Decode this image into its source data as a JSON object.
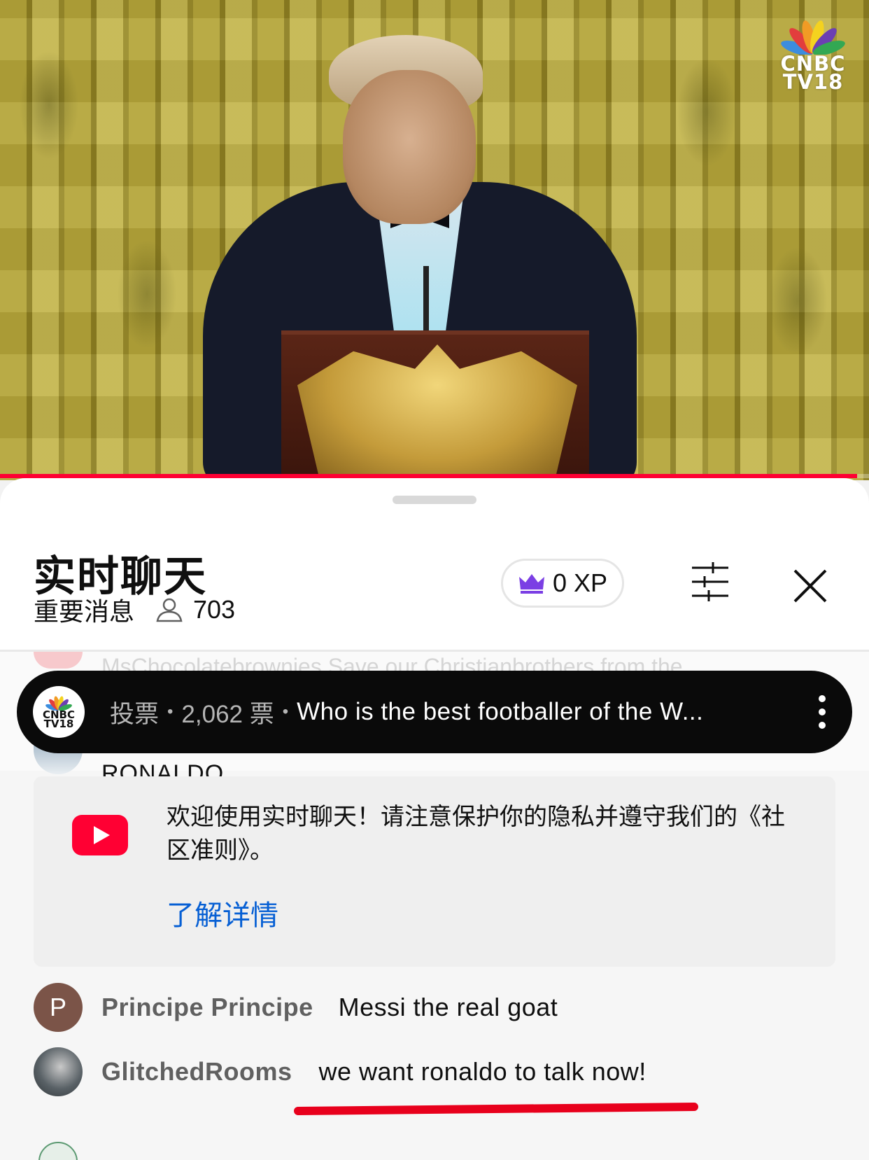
{
  "video": {
    "channel_logo_text": [
      "CNBC",
      "TV18"
    ],
    "progress": 0.986,
    "progress_color": "#ff0033"
  },
  "header": {
    "title": "实时聊天",
    "mode_label": "重要消息",
    "viewer_count": "703",
    "xp_label": "0 XP",
    "icons": [
      "crown-icon",
      "filter-icon",
      "close-icon",
      "person-icon"
    ]
  },
  "poll": {
    "meta_label": "投票",
    "votes": "2,062 票",
    "question": "Who is the best footballer of the W...",
    "channel_avatar_text": [
      "CNBC",
      "TV18"
    ]
  },
  "background_chat": {
    "faded_text": "MsChocolatebrownies   Save our Christianbrothers from the",
    "partial_message": "RONALDO"
  },
  "welcome": {
    "text": "欢迎使用实时聊天！请注意保护你的隐私并遵守我们的《社区准则》。",
    "learn_more": "了解详情"
  },
  "messages": [
    {
      "avatar_letter": "P",
      "author": "Principe Principe",
      "text": "Messi the real goat"
    },
    {
      "avatar_letter": "",
      "author": "GlitchedRooms",
      "text": "we want ronaldo to talk now!"
    }
  ],
  "colors": {
    "accent_red": "#ff0033",
    "link_blue": "#065fd4",
    "crown_purple": "#7b3fe4",
    "youtube_red": "#ff0033"
  }
}
